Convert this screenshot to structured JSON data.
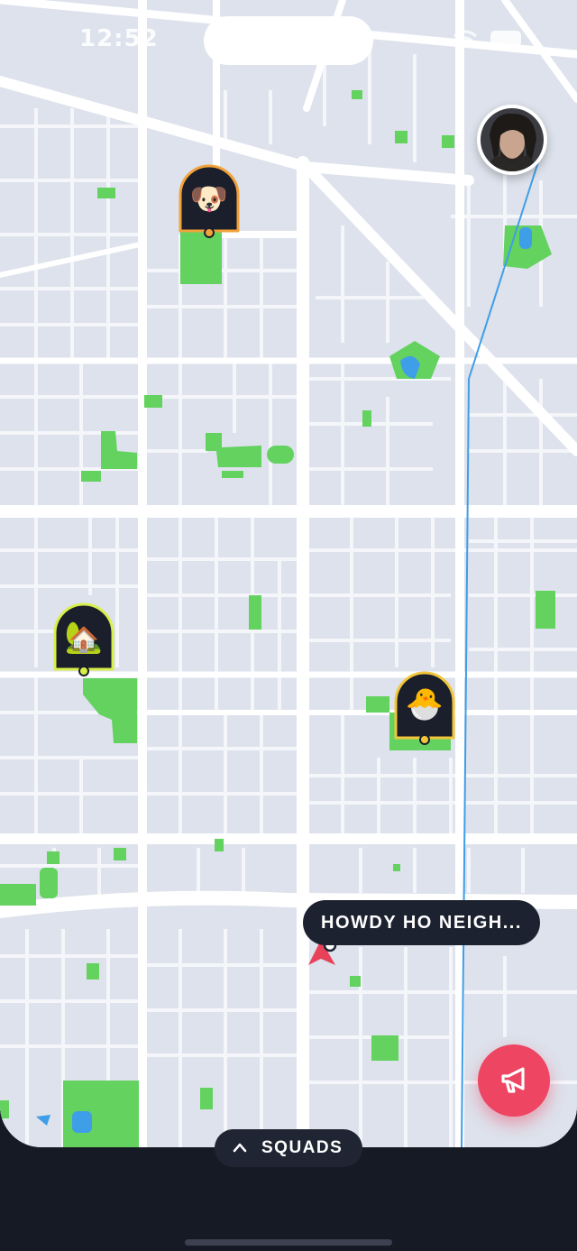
{
  "status_bar": {
    "time": "12:52"
  },
  "map": {
    "colors": {
      "land": "#dde2ec",
      "road": "#ffffff",
      "park": "#63d25f",
      "water": "#3f9ee8",
      "pin": "#1a1f2b"
    }
  },
  "profile": {
    "avatar": "user-avatar-photo"
  },
  "pins": [
    {
      "id": "dog",
      "emoji": "🐶",
      "ring": "#f2a23a"
    },
    {
      "id": "house",
      "emoji": "🏡",
      "ring": "#d8ef4a"
    },
    {
      "id": "chick",
      "emoji": "🐣",
      "ring": "#f2c63a"
    }
  ],
  "message_bubble": {
    "text": "HOWDY HO NEIGH..."
  },
  "current_location": {
    "icon": "location-arrow-icon",
    "color": "#e8425a"
  },
  "fab": {
    "icon": "megaphone-icon",
    "color": "#ed4562"
  },
  "squads_button": {
    "icon": "chevron-up-icon",
    "label": "SQUADS"
  }
}
